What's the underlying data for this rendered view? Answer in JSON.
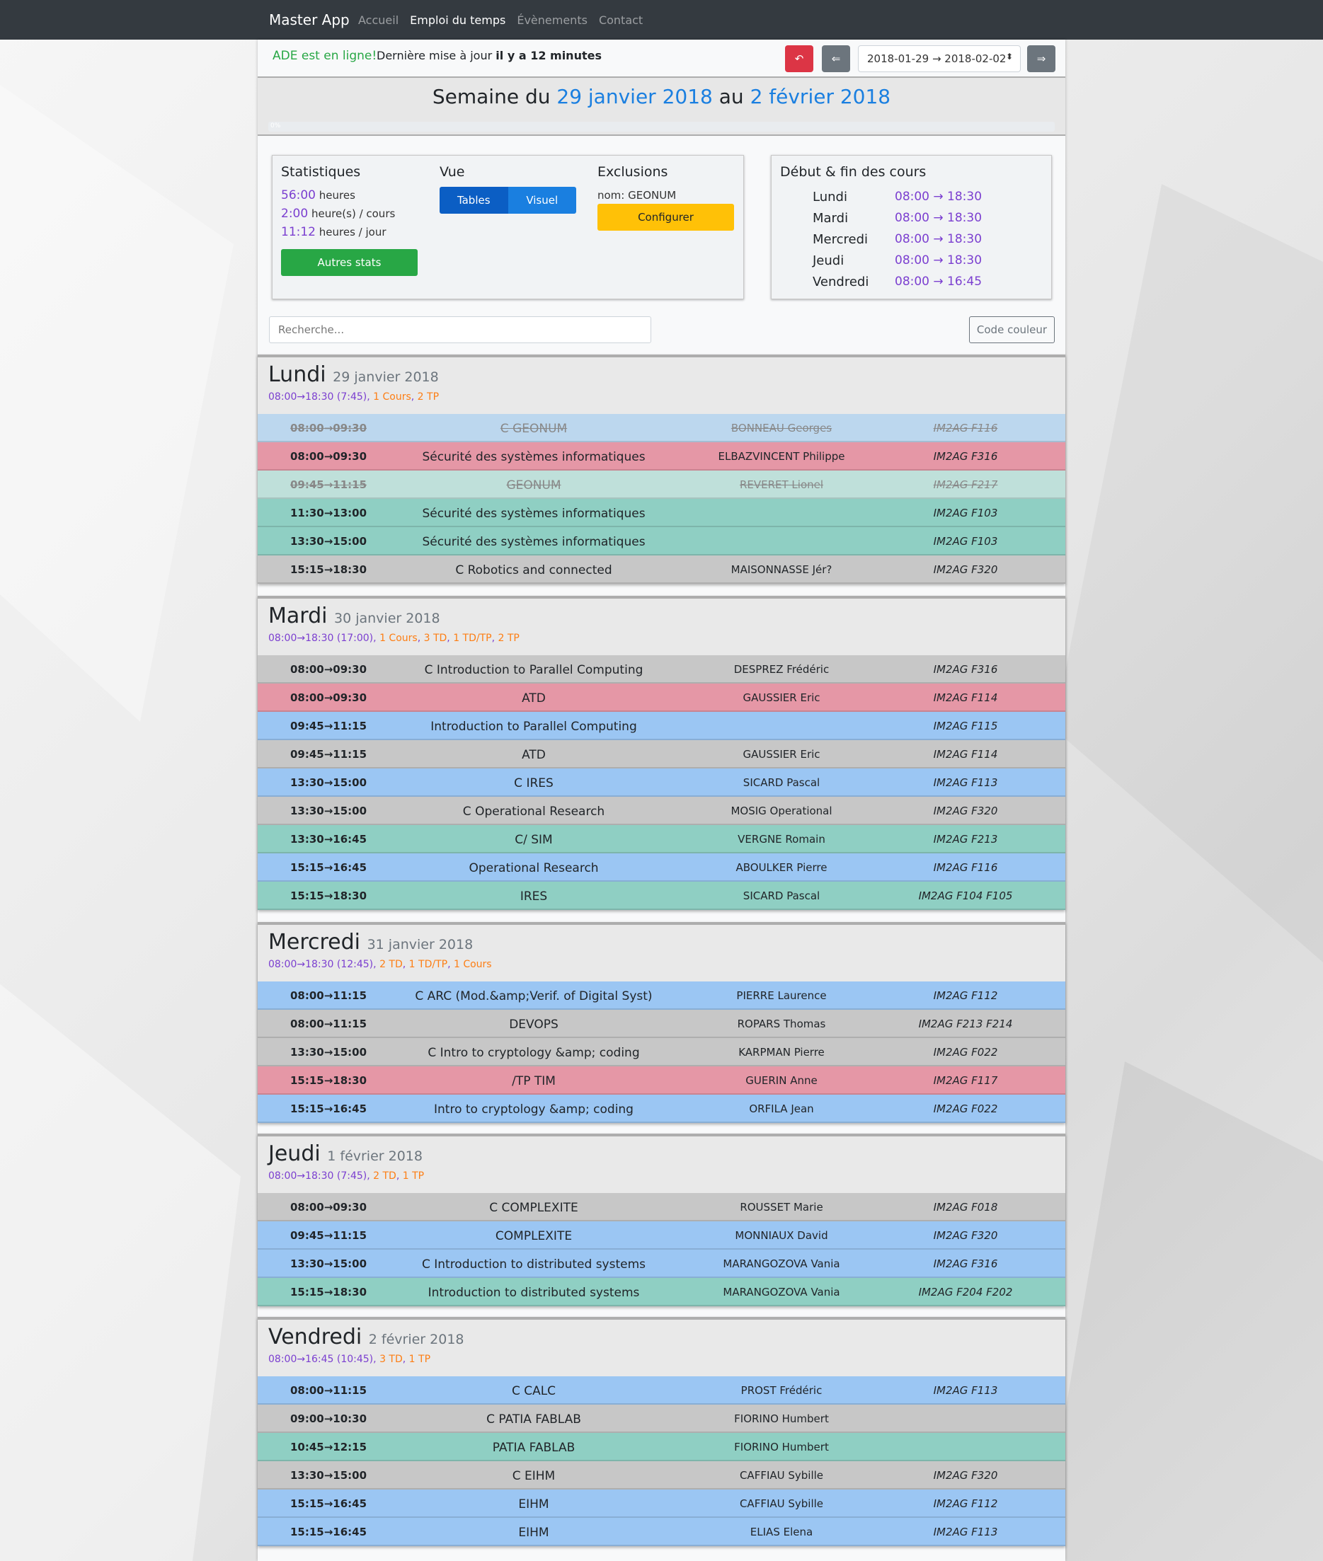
{
  "navbar": {
    "brand": "Master App",
    "links": [
      "Accueil",
      "Emploi du temps",
      "Évènements",
      "Contact"
    ]
  },
  "status": {
    "online": "ADE est en ligne!",
    "updated_prefix": "Dernière mise à jour",
    "updated_value": "il y a 12 minutes"
  },
  "controls": {
    "undo_icon": "↶",
    "prev_icon": "⇐",
    "next_icon": "⇒",
    "week_range": "2018-01-29 → 2018-02-02",
    "select_caret": "⬍"
  },
  "week": {
    "prefix": "Semaine du",
    "start": "29 janvier 2018",
    "middle": "au",
    "end": "2 février 2018",
    "progress_label": "0%",
    "progress": 0
  },
  "stats": {
    "title": "Statistiques",
    "total_value": "56:00",
    "total_unit": "heures",
    "per_course_value": "2:00",
    "per_course_unit": "heure(s) / cours",
    "per_day_value": "11:12",
    "per_day_unit": "heures / jour",
    "more_button": "Autres stats"
  },
  "view": {
    "title": "Vue",
    "tables": "Tables",
    "visual": "Visuel"
  },
  "exclusions": {
    "title": "Exclusions",
    "rule": "nom: GEONUM",
    "configure": "Configurer"
  },
  "hours": {
    "title": "Début & fin des cours",
    "days": [
      {
        "day": "Lundi",
        "range": "08:00 → 18:30"
      },
      {
        "day": "Mardi",
        "range": "08:00 → 18:30"
      },
      {
        "day": "Mercredi",
        "range": "08:00 → 18:30"
      },
      {
        "day": "Jeudi",
        "range": "08:00 → 18:30"
      },
      {
        "day": "Vendredi",
        "range": "08:00 → 16:45"
      }
    ]
  },
  "search": {
    "placeholder": "Recherche..."
  },
  "color_code_button": "Code couleur",
  "days": [
    {
      "name": "Lundi",
      "date": "29 janvier 2018",
      "summary": "08:00→18:30 (7:45)",
      "counts": [
        "1 Cours",
        "2 TP"
      ],
      "events": [
        {
          "time": "08:00→09:30",
          "title": "C GEONUM",
          "prof": "BONNEAU Georges",
          "room": "IM2AG F116",
          "color": "blue-light",
          "struck": true
        },
        {
          "time": "08:00→09:30",
          "title": "Sécurité des systèmes informatiques",
          "prof": "ELBAZVINCENT Philippe",
          "room": "IM2AG F316",
          "color": "pink",
          "struck": false
        },
        {
          "time": "09:45→11:15",
          "title": "GEONUM",
          "prof": "REVERET Lionel",
          "room": "IM2AG F217",
          "color": "teal-light",
          "struck": true
        },
        {
          "time": "11:30→13:00",
          "title": "Sécurité des systèmes informatiques",
          "prof": "",
          "room": "IM2AG F103",
          "color": "teal",
          "struck": false
        },
        {
          "time": "13:30→15:00",
          "title": "Sécurité des systèmes informatiques",
          "prof": "",
          "room": "IM2AG F103",
          "color": "teal",
          "struck": false
        },
        {
          "time": "15:15→18:30",
          "title": "C Robotics and connected",
          "prof": "MAISONNASSE Jér?",
          "room": "IM2AG F320",
          "color": "gray",
          "struck": false
        }
      ]
    },
    {
      "name": "Mardi",
      "date": "30 janvier 2018",
      "summary": "08:00→18:30 (17:00)",
      "counts": [
        "1 Cours",
        "3 TD",
        "1 TD/TP",
        "2 TP"
      ],
      "events": [
        {
          "time": "08:00→09:30",
          "title": "C Introduction to Parallel Computing",
          "prof": "DESPREZ Frédéric",
          "room": "IM2AG F316",
          "color": "gray",
          "struck": false
        },
        {
          "time": "08:00→09:30",
          "title": "ATD",
          "prof": "GAUSSIER Eric",
          "room": "IM2AG F114",
          "color": "pink",
          "struck": false
        },
        {
          "time": "09:45→11:15",
          "title": "Introduction to Parallel Computing",
          "prof": "",
          "room": "IM2AG F115",
          "color": "blue",
          "struck": false
        },
        {
          "time": "09:45→11:15",
          "title": "ATD",
          "prof": "GAUSSIER Eric",
          "room": "IM2AG F114",
          "color": "gray",
          "struck": false
        },
        {
          "time": "13:30→15:00",
          "title": "C IRES",
          "prof": "SICARD Pascal",
          "room": "IM2AG F113",
          "color": "blue",
          "struck": false
        },
        {
          "time": "13:30→15:00",
          "title": "C Operational Research",
          "prof": "MOSIG Operational",
          "room": "IM2AG F320",
          "color": "gray",
          "struck": false
        },
        {
          "time": "13:30→16:45",
          "title": "C/ SIM",
          "prof": "VERGNE Romain",
          "room": "IM2AG F213",
          "color": "teal",
          "struck": false
        },
        {
          "time": "15:15→16:45",
          "title": "Operational Research",
          "prof": "ABOULKER Pierre",
          "room": "IM2AG F116",
          "color": "blue",
          "struck": false
        },
        {
          "time": "15:15→18:30",
          "title": "IRES",
          "prof": "SICARD Pascal",
          "room": "IM2AG F104 F105",
          "color": "teal",
          "struck": false
        }
      ]
    },
    {
      "name": "Mercredi",
      "date": "31 janvier 2018",
      "summary": "08:00→18:30 (12:45)",
      "counts": [
        "2 TD",
        "1 TD/TP",
        "1 Cours"
      ],
      "events": [
        {
          "time": "08:00→11:15",
          "title": "C ARC (Mod.&amp;Verif. of Digital Syst)",
          "prof": "PIERRE Laurence",
          "room": "IM2AG F112",
          "color": "blue",
          "struck": false
        },
        {
          "time": "08:00→11:15",
          "title": "DEVOPS",
          "prof": "ROPARS Thomas",
          "room": "IM2AG F213 F214",
          "color": "gray",
          "struck": false
        },
        {
          "time": "13:30→15:00",
          "title": "C Intro to cryptology &amp; coding",
          "prof": "KARPMAN Pierre",
          "room": "IM2AG F022",
          "color": "gray",
          "struck": false
        },
        {
          "time": "15:15→18:30",
          "title": "/TP TIM",
          "prof": "GUERIN Anne",
          "room": "IM2AG F117",
          "color": "pink",
          "struck": false
        },
        {
          "time": "15:15→16:45",
          "title": "Intro to cryptology &amp; coding",
          "prof": "ORFILA Jean",
          "room": "IM2AG F022",
          "color": "blue",
          "struck": false
        }
      ]
    },
    {
      "name": "Jeudi",
      "date": "1 février 2018",
      "summary": "08:00→18:30 (7:45)",
      "counts": [
        "2 TD",
        "1 TP"
      ],
      "events": [
        {
          "time": "08:00→09:30",
          "title": "C COMPLEXITE",
          "prof": "ROUSSET Marie",
          "room": "IM2AG F018",
          "color": "gray",
          "struck": false
        },
        {
          "time": "09:45→11:15",
          "title": "COMPLEXITE",
          "prof": "MONNIAUX David",
          "room": "IM2AG F320",
          "color": "blue",
          "struck": false
        },
        {
          "time": "13:30→15:00",
          "title": "C Introduction to distributed systems",
          "prof": "MARANGOZOVA Vania",
          "room": "IM2AG F316",
          "color": "blue",
          "struck": false
        },
        {
          "time": "15:15→18:30",
          "title": "Introduction to distributed systems",
          "prof": "MARANGOZOVA Vania",
          "room": "IM2AG F204 F202",
          "color": "teal",
          "struck": false
        }
      ]
    },
    {
      "name": "Vendredi",
      "date": "2 février 2018",
      "summary": "08:00→16:45 (10:45)",
      "counts": [
        "3 TD",
        "1 TP"
      ],
      "events": [
        {
          "time": "08:00→11:15",
          "title": "C CALC",
          "prof": "PROST Frédéric",
          "room": "IM2AG F113",
          "color": "blue",
          "struck": false
        },
        {
          "time": "09:00→10:30",
          "title": "C PATIA FABLAB",
          "prof": "FIORINO Humbert",
          "room": "",
          "color": "gray",
          "struck": false
        },
        {
          "time": "10:45→12:15",
          "title": "PATIA FABLAB",
          "prof": "FIORINO Humbert",
          "room": "",
          "color": "teal",
          "struck": false
        },
        {
          "time": "13:30→15:00",
          "title": "C EIHM",
          "prof": "CAFFIAU Sybille",
          "room": "IM2AG F320",
          "color": "gray",
          "struck": false
        },
        {
          "time": "15:15→16:45",
          "title": "EIHM",
          "prof": "CAFFIAU Sybille",
          "room": "IM2AG F112",
          "color": "blue",
          "struck": false
        },
        {
          "time": "15:15→16:45",
          "title": "EIHM",
          "prof": "ELIAS Elena",
          "room": "IM2AG F113",
          "color": "blue",
          "struck": false
        }
      ]
    }
  ]
}
